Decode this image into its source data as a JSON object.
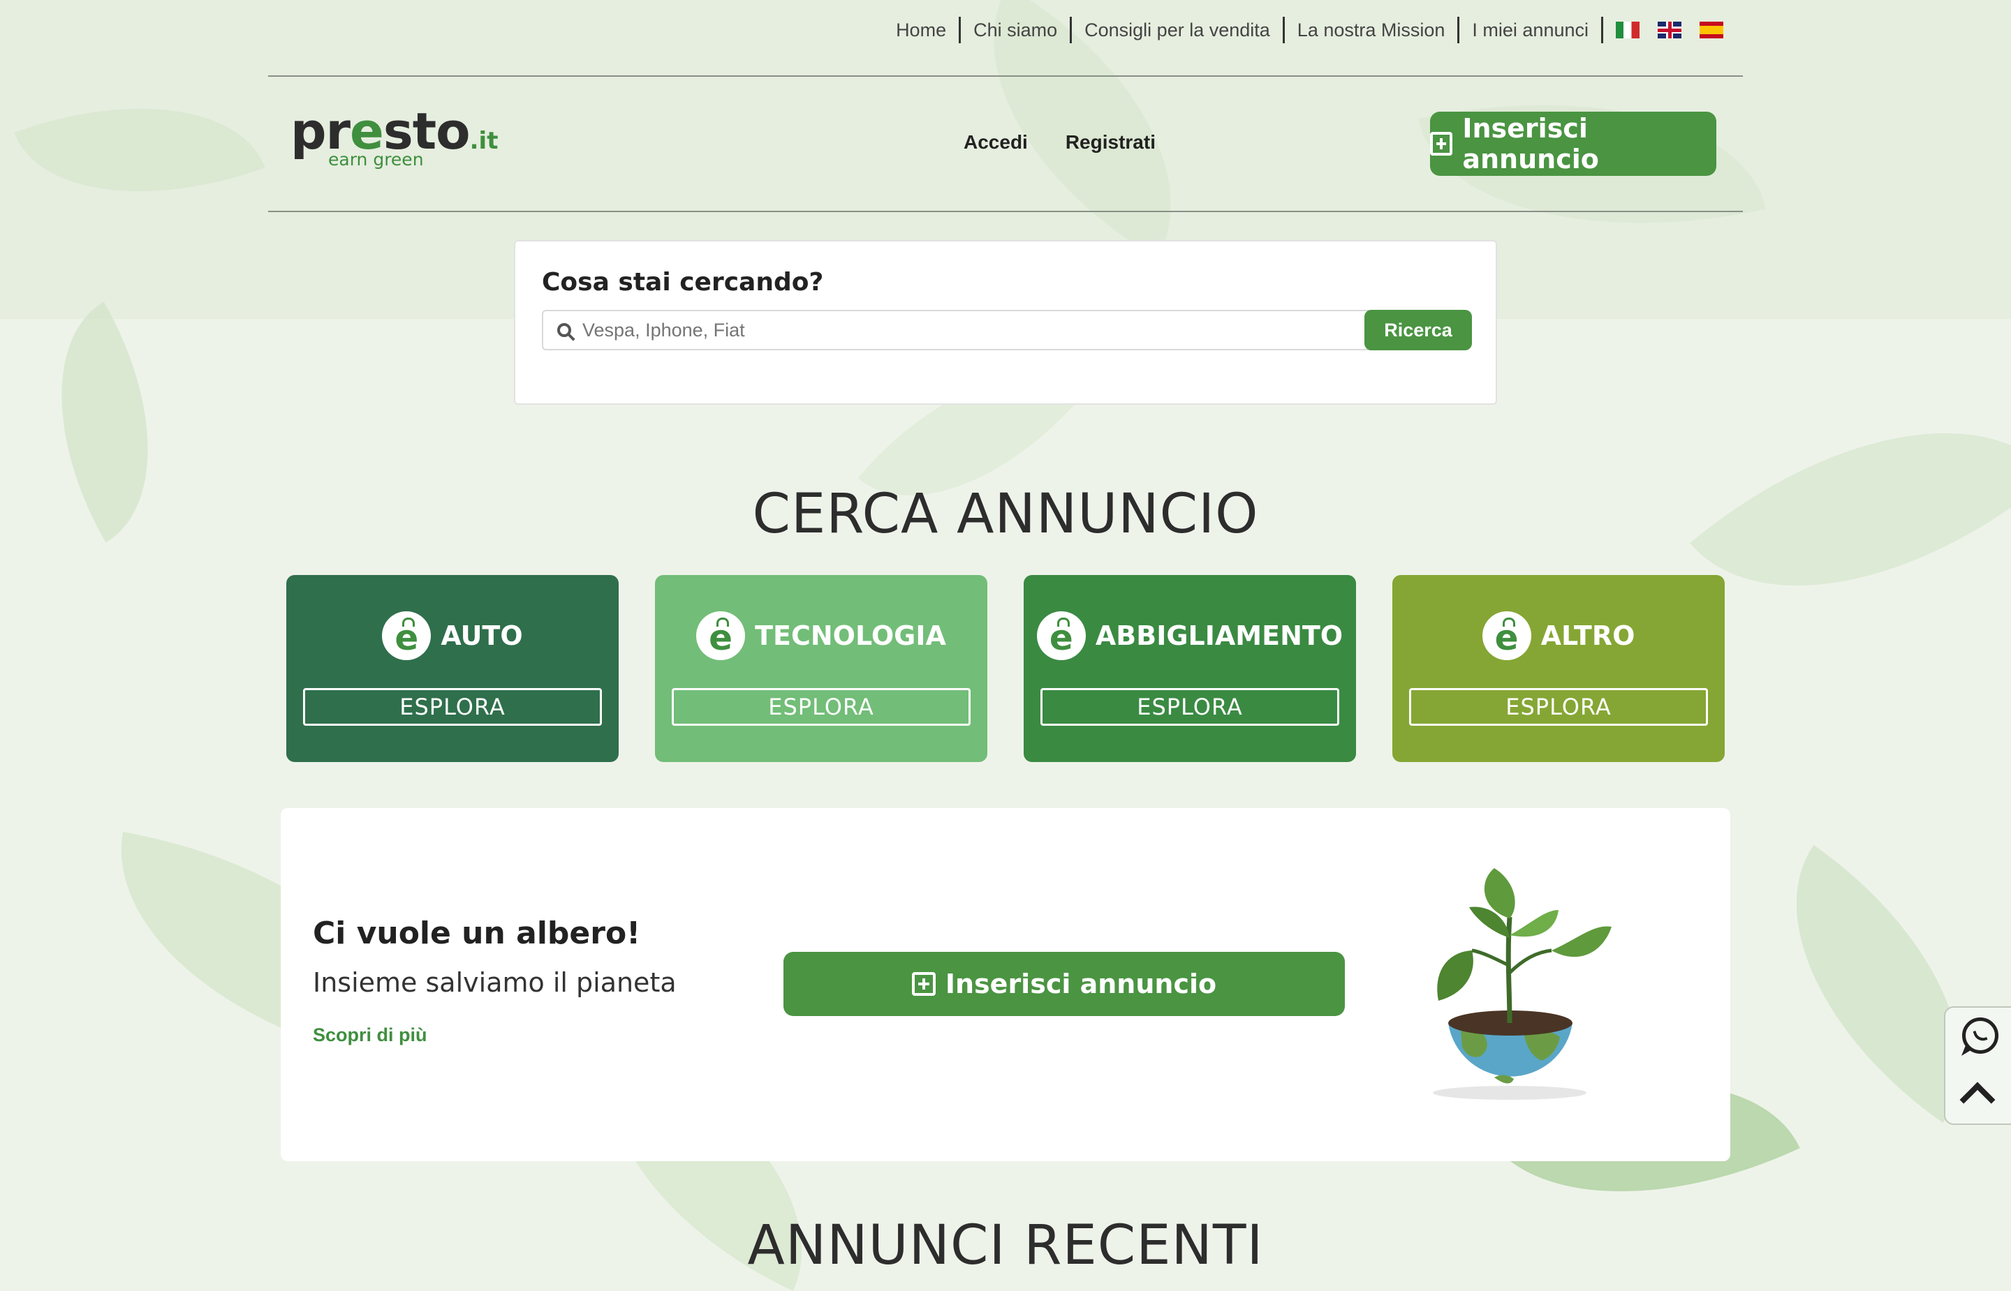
{
  "topnav": {
    "items": [
      "Home",
      "Chi siamo",
      "Consigli per la vendita",
      "La nostra Mission",
      "I miei annunci"
    ],
    "flags": [
      "flag-italy-icon",
      "flag-uk-icon",
      "flag-spain-icon"
    ]
  },
  "logo": {
    "main": "presto",
    "tld": ".it",
    "tagline": "earn green"
  },
  "auth": {
    "login": "Accedi",
    "register": "Registrati"
  },
  "header_cta": {
    "label": "Inserisci annuncio",
    "icon": "plus-square-icon"
  },
  "search": {
    "title": "Cosa stai cercando?",
    "placeholder": "Vespa, Iphone, Fiat",
    "button": "Ricerca",
    "icon": "search-icon"
  },
  "categories_section": {
    "title": "CERCA ANNUNCIO"
  },
  "categories": [
    {
      "name": "AUTO",
      "button": "ESPLORA",
      "color": "#2f6f4c"
    },
    {
      "name": "TECNOLOGIA",
      "button": "ESPLORA",
      "color": "#72bd78"
    },
    {
      "name": "ABBIGLIAMENTO",
      "button": "ESPLORA",
      "color": "#3a8a42"
    },
    {
      "name": "ALTRO",
      "button": "ESPLORA",
      "color": "#85a634"
    }
  ],
  "promo": {
    "title": "Ci vuole un albero!",
    "subtitle": "Insieme salviamo il pianeta",
    "link": "Scopri di più",
    "cta": "Inserisci annuncio"
  },
  "recent_section": {
    "title": "ANNUNCI RECENTI"
  },
  "side_widget": {
    "icons": [
      "whatsapp-icon",
      "scroll-top-icon"
    ]
  },
  "colors": {
    "brand_green": "#4a9442",
    "accent_green": "#3f8f3f"
  }
}
